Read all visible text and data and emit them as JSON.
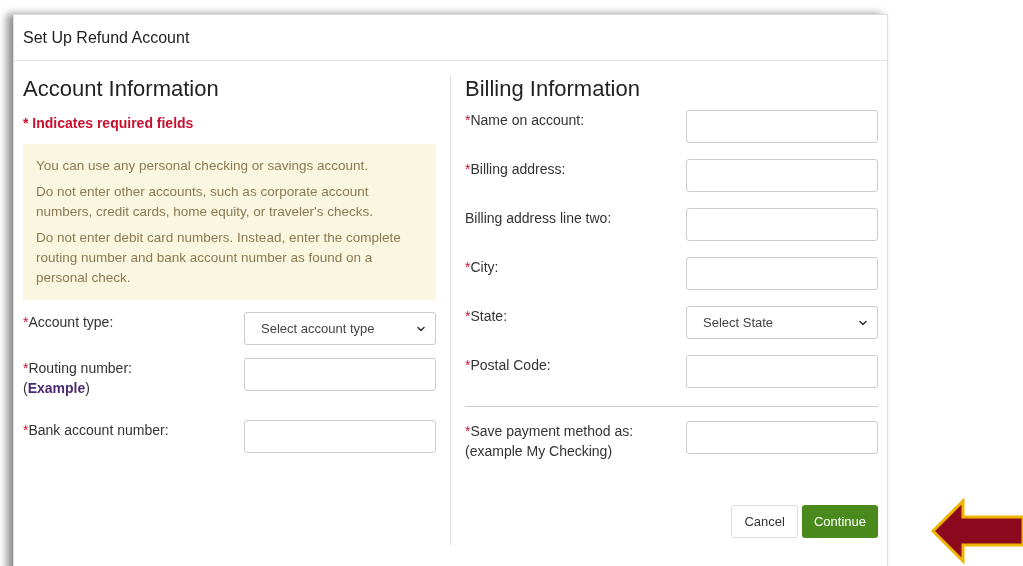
{
  "dialog": {
    "title": "Set Up Refund Account"
  },
  "account_section": {
    "heading": "Account Information",
    "required_note": "* Indicates required fields",
    "notice": [
      "You can use any personal checking or savings account.",
      "Do not enter other accounts, such as corporate account numbers, credit cards, home equity, or traveler's checks.",
      "Do not enter debit card numbers. Instead, enter the complete routing number and bank account number as found on a personal check."
    ],
    "fields": [
      {
        "asterisk": "*",
        "label": "Account type:",
        "kind": "select",
        "placeholder": "Select account type"
      },
      {
        "asterisk": "*",
        "label": "Routing number:",
        "kind": "input",
        "link_open": "(",
        "link": "Example",
        "link_close": ")"
      },
      {
        "asterisk": "*",
        "label": "Bank account number:",
        "kind": "input"
      }
    ]
  },
  "billing_section": {
    "heading": "Billing Information",
    "fields": [
      {
        "asterisk": "*",
        "label": "Name on account:",
        "kind": "input"
      },
      {
        "asterisk": "*",
        "label": "Billing address:",
        "kind": "input"
      },
      {
        "label": "Billing address line two:",
        "kind": "input"
      },
      {
        "asterisk": "*",
        "label": "City:",
        "kind": "input"
      },
      {
        "asterisk": "*",
        "label": "State:",
        "kind": "select",
        "placeholder": "Select State"
      },
      {
        "asterisk": "*",
        "label": "Postal Code:",
        "kind": "input"
      }
    ],
    "save_field": {
      "asterisk": "*",
      "label": "Save payment method as:",
      "note": "(example My Checking)",
      "kind": "input"
    }
  },
  "buttons": [
    {
      "label": "Cancel",
      "kind": "secondary"
    },
    {
      "label": "Continue",
      "kind": "primary"
    }
  ]
}
